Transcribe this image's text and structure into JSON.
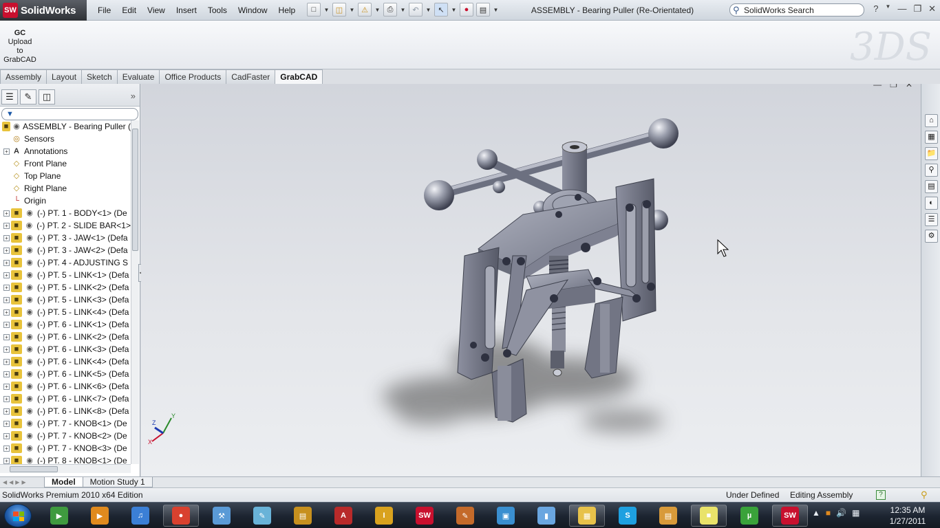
{
  "app": {
    "logo_badge": "SW",
    "name": "SolidWorks",
    "document_title": "ASSEMBLY - Bearing Puller (Re-Orientated)"
  },
  "menu": [
    "File",
    "Edit",
    "View",
    "Insert",
    "Tools",
    "Window",
    "Help"
  ],
  "search": {
    "value": "SolidWorks Search"
  },
  "ribbon": {
    "grabcad_logo": "GC",
    "grabcad_label_1": "Upload",
    "grabcad_label_2": "to",
    "grabcad_label_3": "GrabCAD"
  },
  "tabs": [
    {
      "label": "Assembly",
      "active": false
    },
    {
      "label": "Layout",
      "active": false
    },
    {
      "label": "Sketch",
      "active": false
    },
    {
      "label": "Evaluate",
      "active": false
    },
    {
      "label": "Office Products",
      "active": false
    },
    {
      "label": "CadFaster",
      "active": false
    },
    {
      "label": "GrabCAD",
      "active": true
    }
  ],
  "tree": {
    "root": "ASSEMBLY - Bearing Puller (",
    "items": [
      {
        "label": "Sensors",
        "icon": "sensor-icon",
        "expandable": false
      },
      {
        "label": "Annotations",
        "icon": "annotations-icon",
        "expandable": true
      },
      {
        "label": "Front Plane",
        "icon": "plane-icon",
        "expandable": false
      },
      {
        "label": "Top Plane",
        "icon": "plane-icon",
        "expandable": false
      },
      {
        "label": "Right Plane",
        "icon": "plane-icon",
        "expandable": false
      },
      {
        "label": "Origin",
        "icon": "origin-icon",
        "expandable": false
      },
      {
        "label": "(-) PT. 1 - BODY<1> (De",
        "icon": "part-icon",
        "expandable": true
      },
      {
        "label": "(-) PT. 2 - SLIDE BAR<1>",
        "icon": "part-icon",
        "expandable": true
      },
      {
        "label": "(-) PT. 3 - JAW<1> (Defa",
        "icon": "part-icon",
        "expandable": true
      },
      {
        "label": "(-) PT. 3 - JAW<2> (Defa",
        "icon": "part-icon",
        "expandable": true
      },
      {
        "label": "(-) PT. 4 -  ADJUSTING S",
        "icon": "part-icon",
        "expandable": true
      },
      {
        "label": "(-) PT. 5 - LINK<1> (Defa",
        "icon": "part-icon",
        "expandable": true
      },
      {
        "label": "(-) PT. 5 - LINK<2> (Defa",
        "icon": "part-icon",
        "expandable": true
      },
      {
        "label": "(-) PT. 5 - LINK<3> (Defa",
        "icon": "part-icon",
        "expandable": true
      },
      {
        "label": "(-) PT. 5 - LINK<4> (Defa",
        "icon": "part-icon",
        "expandable": true
      },
      {
        "label": "(-) PT. 6 - LINK<1> (Defa",
        "icon": "part-icon",
        "expandable": true
      },
      {
        "label": "(-) PT. 6 - LINK<2> (Defa",
        "icon": "part-icon",
        "expandable": true
      },
      {
        "label": "(-) PT. 6 - LINK<3> (Defa",
        "icon": "part-icon",
        "expandable": true
      },
      {
        "label": "(-) PT. 6 - LINK<4> (Defa",
        "icon": "part-icon",
        "expandable": true
      },
      {
        "label": "(-) PT. 6 - LINK<5> (Defa",
        "icon": "part-icon",
        "expandable": true
      },
      {
        "label": "(-) PT. 6 - LINK<6> (Defa",
        "icon": "part-icon",
        "expandable": true
      },
      {
        "label": "(-) PT. 6 - LINK<7> (Defa",
        "icon": "part-icon",
        "expandable": true
      },
      {
        "label": "(-) PT. 6 - LINK<8> (Defa",
        "icon": "part-icon",
        "expandable": true
      },
      {
        "label": "(-) PT. 7 - KNOB<1> (De",
        "icon": "part-icon",
        "expandable": true
      },
      {
        "label": "(-) PT. 7 - KNOB<2> (De",
        "icon": "part-icon",
        "expandable": true
      },
      {
        "label": "(-) PT. 7 - KNOB<3> (De",
        "icon": "part-icon",
        "expandable": true
      },
      {
        "label": "(-) PT. 8 - KNOB<1> (De",
        "icon": "part-icon",
        "expandable": true
      }
    ]
  },
  "bottom_tabs": [
    {
      "label": "Model",
      "active": true
    },
    {
      "label": "Motion Study 1",
      "active": false
    }
  ],
  "status": {
    "edition": "SolidWorks Premium 2010 x64 Edition",
    "definition": "Under Defined",
    "mode": "Editing Assembly",
    "help": "?"
  },
  "taskbar": {
    "apps": [
      {
        "name": "windows-media-center-icon",
        "color": "#3f9a3f",
        "running": false
      },
      {
        "name": "media-player-icon",
        "color": "#e08a1e",
        "running": false
      },
      {
        "name": "itunes-icon",
        "color": "#3b7fd6",
        "running": false
      },
      {
        "name": "chrome-icon",
        "color": "#d9412f",
        "running": true
      },
      {
        "name": "cleaner-icon",
        "color": "#5a9ad6",
        "running": false
      },
      {
        "name": "notepad-icon",
        "color": "#69b3d8",
        "running": false
      },
      {
        "name": "winrar-icon",
        "color": "#c7901e",
        "running": false
      },
      {
        "name": "autocad-icon",
        "color": "#b82a2a",
        "running": false
      },
      {
        "name": "inventor-pro-icon",
        "color": "#d9a21e",
        "running": false
      },
      {
        "name": "solidworks-icon",
        "color": "#c8102e",
        "running": false
      },
      {
        "name": "drawing-icon",
        "color": "#c46a2a",
        "running": false
      },
      {
        "name": "package-icon",
        "color": "#3a8fd0",
        "running": false
      },
      {
        "name": "usb-icon",
        "color": "#6aa6e0",
        "running": false
      },
      {
        "name": "explorer-icon",
        "color": "#e7c24a",
        "running": true
      },
      {
        "name": "skype-icon",
        "color": "#1ea0e0",
        "running": false
      },
      {
        "name": "network-icon",
        "color": "#d89a3a",
        "running": false
      },
      {
        "name": "sticky-notes-icon",
        "color": "#e9e36a",
        "running": true
      },
      {
        "name": "utorrent-icon",
        "color": "#3aa23a",
        "running": false
      },
      {
        "name": "solidworks-running-icon",
        "color": "#c8102e",
        "running": true
      }
    ],
    "time": "12:35 AM",
    "date": "1/27/2011"
  }
}
